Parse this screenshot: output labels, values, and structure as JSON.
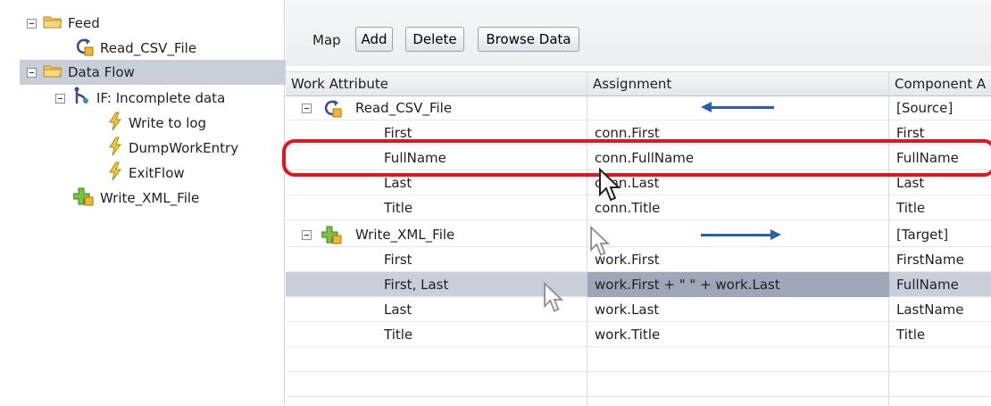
{
  "tree": {
    "feed": "Feed",
    "read_csv": "Read_CSV_File",
    "data_flow": "Data Flow",
    "if_node": "IF: Incomplete data",
    "write_log": "Write to log",
    "dump": "DumpWorkEntry",
    "exit": "ExitFlow",
    "write_xml": "Write_XML_File"
  },
  "toolbar": {
    "map_label": "Map",
    "add_label": "Add",
    "delete_label": "Delete",
    "browse_label": "Browse Data"
  },
  "table": {
    "headers": [
      "Work Attribute",
      "Assignment",
      "Component A"
    ],
    "source_group": {
      "name": "Read_CSV_File",
      "component": "[Source]"
    },
    "source_rows": [
      {
        "attr": "First",
        "assign": "conn.First",
        "comp": "First"
      },
      {
        "attr": "FullName",
        "assign": "conn.FullName",
        "comp": "FullName"
      },
      {
        "attr": "Last",
        "assign": "conn.Last",
        "comp": "Last"
      },
      {
        "attr": "Title",
        "assign": "conn.Title",
        "comp": "Title"
      }
    ],
    "target_group": {
      "name": "Write_XML_File",
      "component": "[Target]"
    },
    "target_rows": [
      {
        "attr": "First",
        "assign": "work.First",
        "comp": "FirstName"
      },
      {
        "attr": "First, Last",
        "assign": "work.First + \" \" + work.Last",
        "comp": "FullName"
      },
      {
        "attr": "Last",
        "assign": "work.Last",
        "comp": "LastName"
      },
      {
        "attr": "Title",
        "assign": "work.Title",
        "comp": "Title"
      }
    ]
  },
  "icons": {
    "folder": "folder-icon",
    "refresh_document": "refresh-document-icon",
    "branch": "branch-icon",
    "lightning": "lightning-icon",
    "plus_document": "plus-document-icon",
    "cursor": "cursor-icon"
  },
  "colors": {
    "selection": "#c9cfd9",
    "highlight_border": "#e3151b",
    "arrow_blue": "#2a5fae"
  }
}
